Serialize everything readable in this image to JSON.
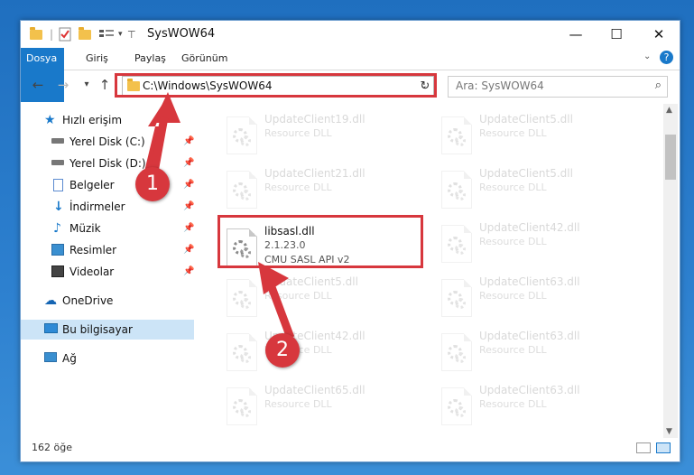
{
  "window": {
    "title": "SysWOW64",
    "minimize": "—",
    "maximize": "☐",
    "close": "✕"
  },
  "ribbon": {
    "tabs": [
      "Dosya",
      "Giriş",
      "Paylaş",
      "Görünüm"
    ]
  },
  "address": {
    "path": "C:\\Windows\\SysWOW64",
    "search_placeholder": "Ara: SysWOW64"
  },
  "sidebar": {
    "quick_access": "Hızlı erişim",
    "items": [
      "Yerel Disk (C:)",
      "Yerel Disk (D:)",
      "Belgeler",
      "İndirmeler",
      "Müzik",
      "Resimler",
      "Videolar"
    ],
    "onedrive": "OneDrive",
    "this_pc": "Bu bilgisayar",
    "network": "Ağ"
  },
  "files": {
    "col1": [
      {
        "name": "UpdateClient19.dll",
        "desc": "Resource DLL"
      },
      {
        "name": "UpdateClient21.dll",
        "desc": "Resource DLL"
      },
      {
        "name": "libsasl.dll",
        "version": "2.1.23.0",
        "desc": "CMU SASL API v2"
      },
      {
        "name": "UpdateClient5.dll",
        "desc": "Resource DLL"
      },
      {
        "name": "UpdateClient42.dll",
        "desc": "Resource DLL"
      },
      {
        "name": "UpdateClient65.dll",
        "desc": "Resource DLL"
      }
    ],
    "col2": [
      {
        "name": "UpdateClient5.dll",
        "desc": "Resource DLL"
      },
      {
        "name": "UpdateClient5.dll",
        "desc": "Resource DLL"
      },
      {
        "name": "UpdateClient42.dll",
        "desc": "Resource DLL"
      },
      {
        "name": "UpdateClient63.dll",
        "desc": "Resource DLL"
      },
      {
        "name": "UpdateClient63.dll",
        "desc": "Resource DLL"
      },
      {
        "name": "UpdateClient63.dll",
        "desc": "Resource DLL"
      }
    ]
  },
  "status": {
    "count": "162 öğe"
  },
  "annotations": {
    "step1": "1",
    "step2": "2"
  },
  "colors": {
    "accent": "#1979ca",
    "highlight": "#d7373d"
  }
}
